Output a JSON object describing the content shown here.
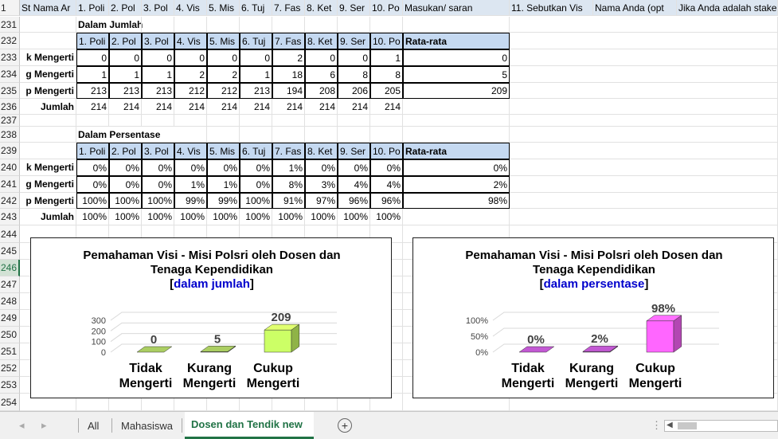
{
  "sheet": {
    "header_row": {
      "num": "1",
      "cells": [
        "St Nama Ar",
        "1. Poli",
        "2. Pol",
        "3. Pol",
        "4. Vis",
        "5. Mis",
        "6. Tuj",
        "7. Fas",
        "8. Ket",
        "9. Ser",
        "10. Po",
        "Masukan/ saran",
        "11. Sebutkan Vis",
        "Nama Anda (opt",
        "Jika Anda adalah stake"
      ]
    },
    "row_nums": {
      "r231": "231",
      "r232": "232",
      "r233": "233",
      "r234": "234",
      "r235": "235",
      "r236": "236",
      "r237": "237",
      "r238": "238",
      "r239": "239",
      "r240": "240",
      "r241": "241",
      "r242": "242",
      "r243": "243",
      "r244": "244",
      "r245": "245",
      "r246": "246",
      "r247": "247",
      "r248": "248",
      "r249": "249",
      "r250": "250",
      "r251": "251",
      "r252": "252",
      "r253": "253",
      "r254": "254"
    },
    "section_jumlah": "Dalam Jumlah",
    "section_persen": "Dalam Persentase",
    "col_headers": [
      "1. Poli",
      "2. Pol",
      "3. Pol",
      "4. Vis",
      "5. Mis",
      "6. Tuj",
      "7. Fas",
      "8. Ket",
      "9. Ser",
      "10. Po"
    ],
    "rata_label": "Rata-rata",
    "jumlah_rows": [
      {
        "label": "k Mengerti",
        "values": [
          "0",
          "0",
          "0",
          "0",
          "0",
          "0",
          "2",
          "0",
          "0",
          "1"
        ],
        "avg": "0"
      },
      {
        "label": "g Mengerti",
        "values": [
          "1",
          "1",
          "1",
          "2",
          "2",
          "1",
          "18",
          "6",
          "8",
          "8"
        ],
        "avg": "5"
      },
      {
        "label": "p Mengerti",
        "values": [
          "213",
          "213",
          "213",
          "212",
          "212",
          "213",
          "194",
          "208",
          "206",
          "205"
        ],
        "avg": "209"
      },
      {
        "label": "Jumlah",
        "values": [
          "214",
          "214",
          "214",
          "214",
          "214",
          "214",
          "214",
          "214",
          "214",
          "214"
        ],
        "avg": ""
      }
    ],
    "persen_rows": [
      {
        "label": "k Mengerti",
        "values": [
          "0%",
          "0%",
          "0%",
          "0%",
          "0%",
          "0%",
          "1%",
          "0%",
          "0%",
          "0%"
        ],
        "avg": "0%"
      },
      {
        "label": "g Mengerti",
        "values": [
          "0%",
          "0%",
          "0%",
          "1%",
          "1%",
          "0%",
          "8%",
          "3%",
          "4%",
          "4%"
        ],
        "avg": "2%"
      },
      {
        "label": "p Mengerti",
        "values": [
          "100%",
          "100%",
          "100%",
          "99%",
          "99%",
          "100%",
          "91%",
          "97%",
          "96%",
          "96%"
        ],
        "avg": "98%"
      },
      {
        "label": "Jumlah",
        "values": [
          "100%",
          "100%",
          "100%",
          "100%",
          "100%",
          "100%",
          "100%",
          "100%",
          "100%",
          "100%"
        ],
        "avg": ""
      }
    ]
  },
  "chart_data": [
    {
      "type": "bar",
      "title": "Pemahaman Visi - Misi Polsri oleh Dosen dan Tenaga Kependidikan",
      "title_line1": "Pemahaman Visi - Misi Polsri oleh Dosen dan",
      "title_line2": "Tenaga Kependidikan",
      "subtitle": "dalam jumlah",
      "categories": [
        "Tidak Mengerti",
        "Kurang Mengerti",
        "Cukup Mengerti"
      ],
      "cat_line1": [
        "Tidak",
        "Kurang",
        "Cukup"
      ],
      "cat_line2": [
        "Mengerti",
        "Mengerti",
        "Mengerti"
      ],
      "values": [
        0,
        5,
        209
      ],
      "value_labels": [
        "0",
        "5",
        "209"
      ],
      "yticks": [
        "0",
        "100",
        "200",
        "300"
      ],
      "ylim": [
        0,
        300
      ],
      "colors": [
        "#9bbb59",
        "#9bbb59",
        "#ccff66"
      ]
    },
    {
      "type": "bar",
      "title": "Pemahaman Visi - Misi Polsri oleh Dosen dan Tenaga Kependidikan",
      "title_line1": "Pemahaman Visi - Misi Polsri oleh Dosen dan",
      "title_line2": "Tenaga Kependidikan",
      "subtitle": "dalam persentase",
      "categories": [
        "Tidak Mengerti",
        "Kurang Mengerti",
        "Cukup Mengerti"
      ],
      "cat_line1": [
        "Tidak",
        "Kurang",
        "Cukup"
      ],
      "cat_line2": [
        "Mengerti",
        "Mengerti",
        "Mengerti"
      ],
      "values": [
        0,
        2,
        98
      ],
      "value_labels": [
        "0%",
        "2%",
        "98%"
      ],
      "yticks": [
        "0%",
        "50%",
        "100%"
      ],
      "ylim": [
        0,
        100
      ],
      "colors": [
        "#b050c0",
        "#b050c0",
        "#ff66ff"
      ]
    }
  ],
  "tabs": {
    "all": "All",
    "mahasiswa": "Mahasiswa",
    "dosen": "Dosen dan Tendik new",
    "add": "+"
  }
}
